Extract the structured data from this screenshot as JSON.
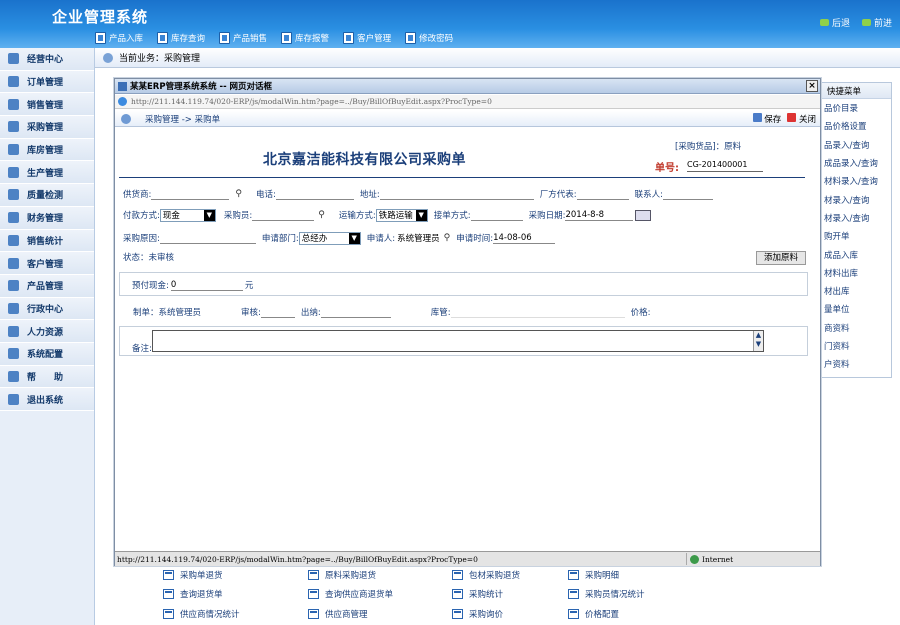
{
  "app": {
    "title": "企业管理系统",
    "back_label": "后退",
    "forward_label": "前进"
  },
  "toolbar": [
    {
      "label": "产品入库",
      "icon": "stock-in-icon"
    },
    {
      "label": "库存查询",
      "icon": "inventory-search-icon"
    },
    {
      "label": "产品销售",
      "icon": "sales-icon"
    },
    {
      "label": "库存报警",
      "icon": "alarm-icon"
    },
    {
      "label": "客户管理",
      "icon": "customer-icon"
    },
    {
      "label": "修改密码",
      "icon": "key-icon"
    }
  ],
  "sidebar": {
    "items": [
      {
        "label": "经营中心",
        "icon": "business-center-icon"
      },
      {
        "label": "订单管理",
        "icon": "order-icon"
      },
      {
        "label": "销售管理",
        "icon": "sales-chart-icon"
      },
      {
        "label": "采购管理",
        "icon": "purchase-icon"
      },
      {
        "label": "库房管理",
        "icon": "warehouse-icon"
      },
      {
        "label": "生产管理",
        "icon": "production-icon"
      },
      {
        "label": "质量检测",
        "icon": "quality-icon"
      },
      {
        "label": "财务管理",
        "icon": "finance-icon"
      },
      {
        "label": "销售统计",
        "icon": "statistics-icon"
      },
      {
        "label": "客户管理",
        "icon": "customer-icon"
      },
      {
        "label": "产品管理",
        "icon": "product-icon"
      },
      {
        "label": "行政中心",
        "icon": "admin-icon"
      },
      {
        "label": "人力资源",
        "icon": "hr-icon"
      },
      {
        "label": "系统配置",
        "icon": "settings-icon"
      },
      {
        "label": "帮　　助",
        "icon": "help-icon"
      },
      {
        "label": "退出系统",
        "icon": "exit-icon"
      }
    ]
  },
  "crumb": {
    "label": "当前业务：采购管理"
  },
  "quick_menu": {
    "title": "快捷菜单",
    "items": [
      "品价目录",
      "品价格设置",
      "品录入/查询",
      "成品录入/查询",
      "材料录入/查询",
      "材录入/查询",
      "材录入/查询",
      "购开单",
      "成品入库",
      "材料出库",
      "材出库",
      "量单位",
      "商资料",
      "门资料",
      "户资料"
    ]
  },
  "links": [
    [
      "采购单退货",
      "原料采购退货",
      "包材采购退货",
      "采购明细"
    ],
    [
      "查询退货单",
      "查询供应商退货单",
      "采购统计",
      "采购员情况统计"
    ],
    [
      "供应商情况统计",
      "供应商管理",
      "采购询价",
      "价格配置"
    ]
  ],
  "dialog": {
    "title": "某某ERP管理系统系统 -- 网页对话框",
    "address": "http://211.144.119.74/020-ERP/js/modalWin.htm?page=../Buy/BillOfBuyEdit.aspx?ProcType=0",
    "nav": "采购管理 -> 采购单",
    "save_label": "保存",
    "close_label": "关闭",
    "category": "[采购货品]：原料",
    "company": "北京嘉洁能科技有限公司采购单",
    "order_label": "单号:",
    "order_no": "CG-201400001",
    "status_url": "http://211.144.119.74/020-ERP/js/modalWin.htm?page=../Buy/BillOfBuyEdit.aspx?ProcType=0",
    "zone": "Internet"
  },
  "form": {
    "supplier": "供货商:",
    "phone": "电话:",
    "address": "地址:",
    "maker_code": "厂方代表:",
    "contact": "联系人:",
    "pay_method": "付款方式:",
    "pay_value": "现金",
    "buyer": "采购员:",
    "transport": "运输方式:",
    "transport_value": "铁路运输",
    "receive": "接单方式:",
    "buy_date": "采购日期:",
    "buy_date_value": "2014-8-8",
    "reason": "采购原因:",
    "dept": "申请部门:",
    "dept_value": "总经办",
    "applicant": "申请人:",
    "applicant_value": "系统管理员",
    "apply_time": "申请时间:",
    "apply_time_value": "14-08-06",
    "status": "状态：未审核",
    "add_button": "添加原料",
    "prepay": "预付现金:",
    "prepay_value": "0",
    "prepay_unit": "元",
    "maker": "制单：系统管理员",
    "audit": "审核:",
    "cashier": "出纳:",
    "storekeeper": "库管:",
    "price": "价格:",
    "remark": "备注:"
  }
}
